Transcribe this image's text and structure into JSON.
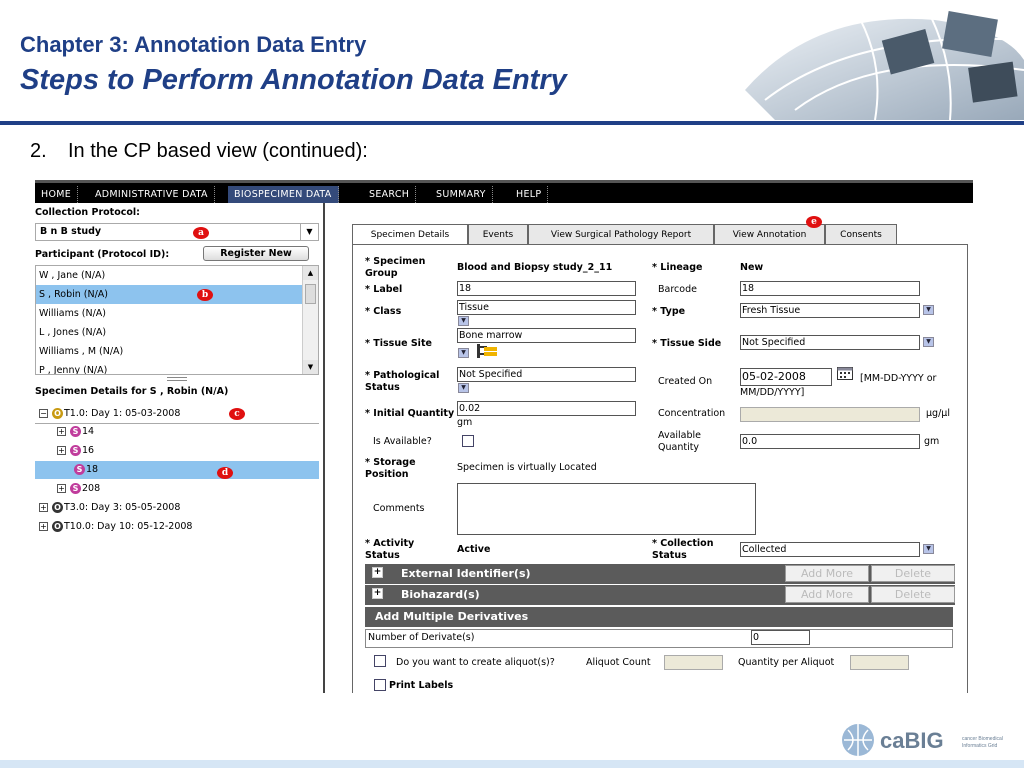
{
  "slide": {
    "title": "Chapter 3: Annotation Data Entry",
    "subtitle": "Steps to Perform Annotation Data Entry",
    "step_number": "2.",
    "step_text": "In the CP based view (continued):"
  },
  "nav": [
    "HOME",
    "ADMINISTRATIVE DATA",
    "BIOSPECIMEN DATA",
    "SEARCH",
    "SUMMARY",
    "HELP"
  ],
  "left": {
    "cp_label": "Collection Protocol:",
    "cp_value": "B n B study",
    "participant_label": "Participant (Protocol ID):",
    "register_button": "Register New",
    "participants": [
      "W , Jane (N/A)",
      "S , Robin (N/A)",
      "Williams (N/A)",
      "L , Jones (N/A)",
      "Williams , M (N/A)",
      "P , Jenny (N/A)"
    ],
    "specimen_details_label": "Specimen Details for  S , Robin (N/A)",
    "tree": {
      "t1": "T1.0: Day 1: 05-03-2008",
      "s14": "14",
      "s16": "16",
      "s18": "18",
      "s208": "208",
      "t3": "T3.0: Day 3: 05-05-2008",
      "t10": "T10.0: Day 10: 05-12-2008"
    }
  },
  "callouts": {
    "a": "a",
    "b": "b",
    "c": "c",
    "d": "d",
    "e": "e"
  },
  "tabs": [
    "Specimen Details",
    "Events",
    "View Surgical Pathology Report",
    "View Annotation",
    "Consents"
  ],
  "form": {
    "specimen_group_label": "Specimen Group",
    "specimen_group_value": "Blood and Biopsy study_2_11",
    "lineage_label": "Lineage",
    "lineage_value": "New",
    "label_label": "Label",
    "label_value": "18",
    "barcode_label": "Barcode",
    "barcode_value": "18",
    "class_label": "Class",
    "class_value": "Tissue",
    "type_label": "Type",
    "type_value": "Fresh Tissue",
    "tissue_site_label": "Tissue Site",
    "tissue_site_value": "Bone marrow",
    "tissue_side_label": "Tissue Side",
    "tissue_side_value": "Not Specified",
    "pathological_status_label": "Pathological Status",
    "pathological_status_value": "Not Specified",
    "created_on_label": "Created On",
    "created_on_value": "05-02-2008",
    "created_on_format": "[MM-DD-YYYY or MM/DD/YYYY]",
    "initial_quantity_label": "Initial Quantity",
    "initial_quantity_value": "0.02",
    "initial_quantity_unit": "gm",
    "concentration_label": "Concentration",
    "concentration_unit": "µg/µl",
    "is_available_label": "Is Available?",
    "available_quantity_label": "Available Quantity",
    "available_quantity_value": "0.0",
    "available_quantity_unit": "gm",
    "storage_position_label": "Storage Position",
    "storage_position_value": "Specimen is virtually Located",
    "comments_label": "Comments",
    "activity_status_label": "Activity Status",
    "activity_status_value": "Active",
    "collection_status_label": "Collection Status",
    "collection_status_value": "Collected"
  },
  "sections": {
    "external_identifier": "External Identifier(s)",
    "biohazard": "Biohazard(s)",
    "add_more": "Add More",
    "delete": "Delete",
    "add_multiple_derivatives": "Add Multiple Derivatives",
    "number_of_derivates_label": "Number of Derivate(s)",
    "number_of_derivates_value": "0",
    "aliquot_question": "Do you want to create aliquot(s)?",
    "aliquot_count_label": "Aliquot Count",
    "quantity_per_aliquot_label": "Quantity per Aliquot",
    "print_labels": "Print Labels"
  },
  "footer": {
    "logo_text": "caBIG",
    "logo_tag": "cancer Biomedical Informatics Grid"
  },
  "colors": {
    "title_blue": "#1f3f86",
    "selection_blue": "#8dc3ee",
    "callout_red": "#e01010",
    "section_gray": "#5b5b5b"
  }
}
